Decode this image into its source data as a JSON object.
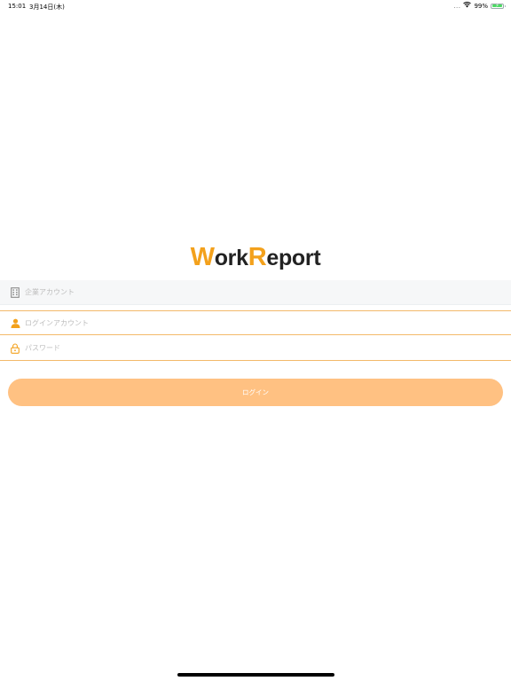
{
  "status_bar": {
    "time": "15:01",
    "date": "3月14日(木)",
    "dots": "...",
    "battery_pct": "99%",
    "battery_level": 0.99,
    "battery_color": "#4cd964"
  },
  "logo": {
    "w_cap": "W",
    "w_rest": "ork",
    "r_cap": "R",
    "r_rest": "eport",
    "accent": "#f3a11c"
  },
  "form": {
    "company_placeholder": "企業アカウント",
    "company_icon": "building-icon",
    "login_placeholder": "ログインアカウント",
    "login_icon": "user-icon",
    "password_placeholder": "パスワード",
    "password_icon": "lock-icon",
    "submit_label": "ログイン",
    "submit_color": "#ffc182"
  }
}
